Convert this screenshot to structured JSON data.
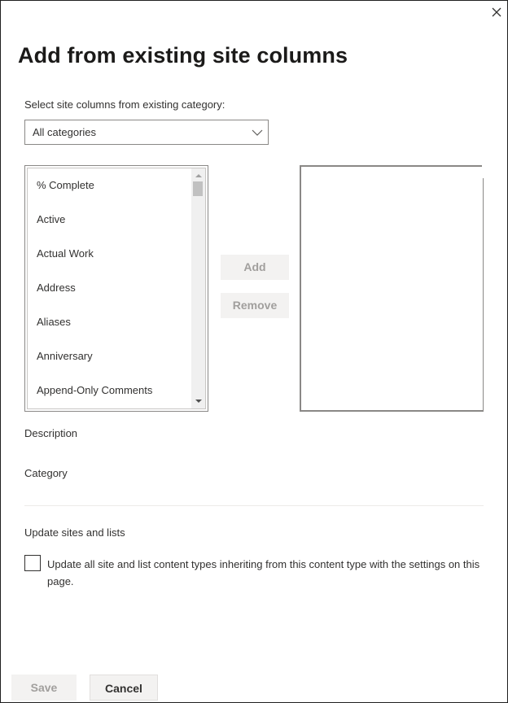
{
  "dialog": {
    "title": "Add from existing site columns",
    "close_icon": "close-icon"
  },
  "category_select": {
    "label": "Select site columns from existing category:",
    "value": "All categories",
    "icon": "chevron-down-icon"
  },
  "available_columns": {
    "items": [
      "% Complete",
      "Active",
      "Actual Work",
      "Address",
      "Aliases",
      "Anniversary",
      "Append-Only Comments"
    ],
    "scroll_up_icon": "scroll-up-arrow-icon",
    "scroll_down_icon": "scroll-down-arrow-icon"
  },
  "actions": {
    "add_label": "Add",
    "remove_label": "Remove"
  },
  "selected_columns": {
    "items": []
  },
  "details": {
    "description_label": "Description",
    "category_label": "Category"
  },
  "update_section": {
    "heading": "Update sites and lists",
    "checkbox_label": "Update all site and list content types inheriting from this content type with the settings on this page.",
    "checked": false
  },
  "footer": {
    "save_label": "Save",
    "cancel_label": "Cancel"
  },
  "colors": {
    "border": "#8a8886",
    "disabled_button_bg": "#f3f2f1",
    "disabled_text": "#a19f9d",
    "text": "#323130"
  }
}
